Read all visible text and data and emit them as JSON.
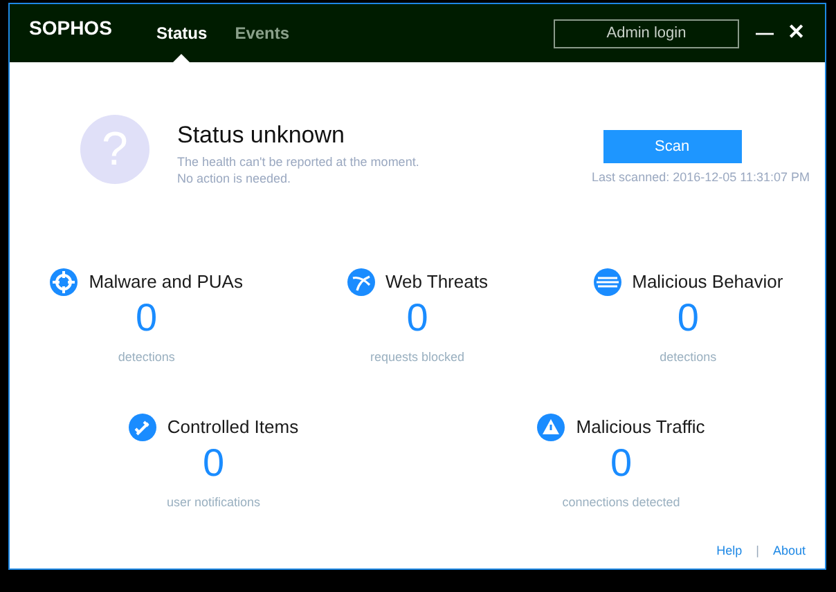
{
  "header": {
    "logo": "SOPHOS",
    "tabs": [
      {
        "label": "Status",
        "selected": true
      },
      {
        "label": "Events",
        "selected": false
      }
    ],
    "admin_button": "Admin login",
    "minimize": "—",
    "close": "✕"
  },
  "status": {
    "icon": "?",
    "title": "Status unknown",
    "lines": [
      "The health can't be reported at the moment.",
      "No action is needed."
    ],
    "scan_button": "Scan",
    "last_scanned": "Last scanned: 2016-12-05 11:31:07 PM"
  },
  "stat_rows": [
    [
      {
        "title": "Malware and PUAs",
        "count": "0",
        "caption": "detections"
      },
      {
        "title": "Web Threats",
        "count": "0",
        "caption": "requests blocked"
      },
      {
        "title": "Malicious Behavior",
        "count": "0",
        "caption": "detections"
      }
    ],
    [
      {
        "title": "Controlled Items",
        "count": "0",
        "caption": "user notifications"
      },
      {
        "title": "Malicious Traffic",
        "count": "0",
        "caption": "connections detected"
      }
    ]
  ],
  "footer": {
    "links": [
      "Help",
      "About"
    ],
    "separator": "|"
  }
}
